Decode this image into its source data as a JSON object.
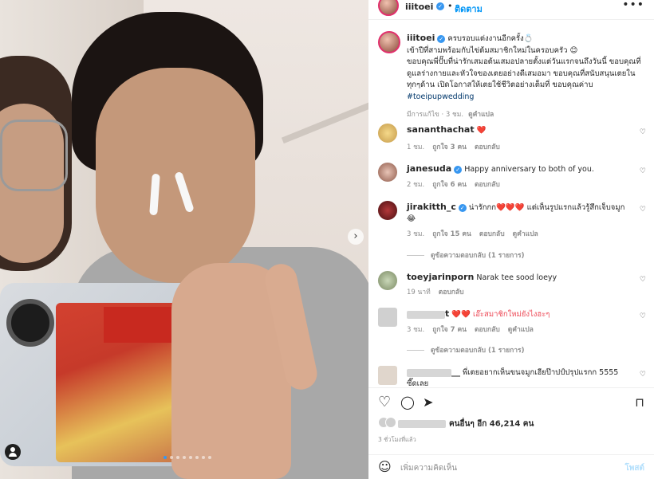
{
  "post": {
    "username": "iiitoei",
    "follow_label": "ติดตาม",
    "more_label": "•••"
  },
  "caption": {
    "username": "iiitoei",
    "line1": "ครบรอบแต่งงานอีกครั้ง💍",
    "line2": "เข้าปีที่สามพร้อมกับไข่ต้มสมาชิกใหม่ในครอบครัว 😊",
    "line3": "ขอบคุณพี่ปั๊บที่น่ารักเสมอต้นเสมอปลายตั้งแต่วันแรกจนถึงวันนี้ ขอบคุณที่ดูแลร่างกายและหัวใจของเตยอย่างดีเสมอมา ขอบคุณที่สนับสนุนเตยในทุกๆด้าน เปิดโอกาสให้เตยใช้ชีวิตอย่างเต็มที่ ขอบคุณค่าบ",
    "hashtag": "#toeipupwedding",
    "edited": "มีการแก้ไข · 3 ชม.",
    "translate": "ดูคำแปล"
  },
  "comments": [
    {
      "username": "sananthachat",
      "text": "❤️",
      "time": "1 ชม.",
      "likes": "ถูกใจ 3 คน",
      "reply": "ตอบกลับ",
      "translate": ""
    },
    {
      "username": "janesuda",
      "text": "Happy anniversary to both of you.",
      "time": "2 ชม.",
      "likes": "ถูกใจ 6 คน",
      "reply": "ตอบกลับ",
      "translate": ""
    },
    {
      "username": "jirakitth_c",
      "text": "น่ารักกก❤️❤️❤️ แต่เห็นรูปแรกแล้วรู้สึกเจ็บจมูก 😂",
      "time": "3 ชม.",
      "likes": "ถูกใจ 15 คน",
      "reply": "ตอบกลับ",
      "translate": "ดูคำแปล"
    },
    {
      "username": "toeyjarinporn",
      "text": "Narak tee sood loeyy",
      "time": "19 นาที",
      "likes": "",
      "reply": "ตอบกลับ",
      "translate": ""
    },
    {
      "username": "t",
      "text": "❤️❤️ เอ๊ะสมาชิกใหม่ยังไงฮะๆ",
      "time": "3 ชม.",
      "likes": "ถูกใจ 7 คน",
      "reply": "ตอบกลับ",
      "translate": "ดูคำแปล"
    },
    {
      "username": "__",
      "text": "พี่เตยอยากเห็นขนจมูกเฮียป๊าปป์ปรุปแรกก 5555 ซี๊ดเลย",
      "time": "",
      "likes": "",
      "reply": "",
      "translate": ""
    }
  ],
  "view_replies_1": "ดูข้อความตอบกลับ (1 รายการ)",
  "view_replies_2": "ดูข้อความตอบกลับ (1 รายการ)",
  "likes_text": "คนอื่นๆ อีก 46,214 คน",
  "time_ago": "3 ชั่วโมงที่แล้ว",
  "add_comment": {
    "placeholder": "เพิ่มความคิดเห็น",
    "post_label": "โพสต์"
  },
  "icons": {
    "verified": "verified-badge-icon",
    "heart": "heart-icon",
    "comment": "comment-icon",
    "share": "share-icon",
    "save": "bookmark-icon",
    "emoji": "emoji-icon",
    "next": "chevron-right-icon",
    "user_tag": "user-tag-icon"
  },
  "colors": {
    "accent": "#0095f6",
    "verified": "#3897f0",
    "hashtag": "#00376b",
    "muted": "#8e8e8e"
  }
}
